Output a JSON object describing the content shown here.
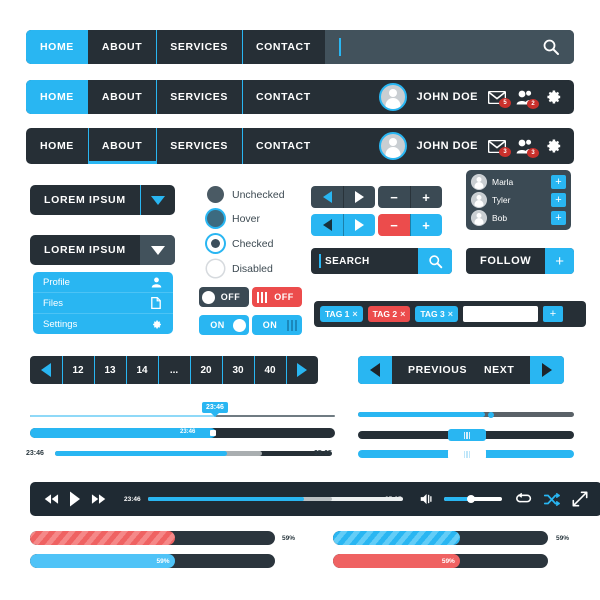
{
  "colors": {
    "blue": "#29b6f2",
    "dark": "#262f36",
    "slate": "#3b4a54",
    "red": "#ec4c4c",
    "white": "#ffffff"
  },
  "navbars": [
    {
      "id": "navbar-search",
      "items": [
        "HOME",
        "ABOUT",
        "SERVICES",
        "CONTACT"
      ],
      "active_index": 0,
      "search": {
        "value": "",
        "placeholder": ""
      }
    },
    {
      "id": "navbar-user",
      "items": [
        "HOME",
        "ABOUT",
        "SERVICES",
        "CONTACT"
      ],
      "active_index": 0,
      "username": "JOHN DOE",
      "mail_badge": "5",
      "friends_badge": "2"
    },
    {
      "id": "navbar-user-underline",
      "items": [
        "HOME",
        "ABOUT",
        "SERVICES",
        "CONTACT"
      ],
      "active_index": 1,
      "username": "JOHN DOE",
      "mail_badge": "3",
      "friends_badge": "3"
    }
  ],
  "dropdowns": [
    {
      "label": "LOREM IPSUM",
      "state": "default"
    },
    {
      "label": "LOREM IPSUM",
      "state": "hovered"
    }
  ],
  "menu": {
    "items": [
      {
        "label": "Profile",
        "icon": "user-icon"
      },
      {
        "label": "Files",
        "icon": "file-icon"
      },
      {
        "label": "Settings",
        "icon": "gear-icon"
      }
    ]
  },
  "radios": [
    {
      "label": "Unchecked",
      "state": "unchecked"
    },
    {
      "label": "Hover",
      "state": "hover"
    },
    {
      "label": "Checked",
      "state": "checked"
    },
    {
      "label": "Disabled",
      "state": "disabled"
    }
  ],
  "steppers": [
    {
      "id": "arrows-dark",
      "left": "prev-arrow-icon",
      "right": "next-arrow-icon",
      "theme": "dark"
    },
    {
      "id": "arrows-blue",
      "left": "prev-arrow-icon",
      "right": "next-arrow-icon",
      "theme": "blue"
    },
    {
      "id": "plusminus-dark",
      "left": "−",
      "right": "+",
      "theme": "dark"
    },
    {
      "id": "plusminus-color",
      "left": "−",
      "right": "+",
      "theme": "color"
    }
  ],
  "search_field": {
    "value": "SEARCH",
    "button_icon": "search-icon"
  },
  "follow_button": {
    "label": "FOLLOW",
    "plus": "+"
  },
  "user_list": [
    {
      "name": "Marla",
      "action": "+"
    },
    {
      "name": "Tyler",
      "action": "+"
    },
    {
      "name": "Bob",
      "action": "+"
    }
  ],
  "toggles": [
    {
      "id": "toggle-off-dark",
      "text": "OFF",
      "theme": "off-dark",
      "knob": "circle",
      "knob_side": "left"
    },
    {
      "id": "toggle-off-red",
      "text": "OFF",
      "theme": "off-red",
      "knob": "bars",
      "knob_side": "left"
    },
    {
      "id": "toggle-on-blue",
      "text": "ON",
      "theme": "on-blue",
      "knob": "circle",
      "knob_side": "right"
    },
    {
      "id": "toggle-on-blue-bars",
      "text": "ON",
      "theme": "on-blue",
      "knob": "bars",
      "knob_side": "right"
    }
  ],
  "tags": {
    "items": [
      {
        "label": "TAG 1",
        "color": "blue",
        "close": "×"
      },
      {
        "label": "TAG 2",
        "color": "red",
        "close": "×"
      },
      {
        "label": "TAG 3",
        "color": "blue",
        "close": "×"
      }
    ],
    "input_value": "",
    "add_label": "+"
  },
  "pagination": {
    "prev_icon": "prev-arrow-icon",
    "pages": [
      "12",
      "13",
      "14",
      "...",
      "20",
      "30",
      "40"
    ],
    "next_icon": "next-arrow-icon"
  },
  "prev_next": {
    "previous_label": "PREVIOUS",
    "next_label": "NEXT"
  },
  "sliders": {
    "tooltip_time": "23:46",
    "start_time": "23:46",
    "end_time": "35:05",
    "thin_fill_pct": 61,
    "thick_fill_pct": 61,
    "labeled_fill_pct": 62,
    "labeled_secondary_pct": 75,
    "right_thin_pct": 61,
    "right_thick_pct": 57,
    "right_light_pct": 55
  },
  "player": {
    "rewind_icon": "rewind-icon",
    "play_icon": "play-icon",
    "forward_icon": "fast-forward-icon",
    "current_time": "23:46",
    "total_time": "35:05",
    "progress_pct": 61,
    "buffer_pct": 72,
    "volume_icon": "volume-icon",
    "volume_pct": 45,
    "repeat_icon": "repeat-icon",
    "shuffle_icon": "shuffle-icon",
    "fullscreen_icon": "fullscreen-icon"
  },
  "progress_bars": [
    {
      "id": "progress-striped-red",
      "pct": 59,
      "label": "59%",
      "style": "striped-red",
      "label_pos": "outside"
    },
    {
      "id": "progress-solid-blue",
      "pct": 59,
      "label": "59%",
      "style": "blue",
      "label_pos": "inside"
    },
    {
      "id": "progress-striped-blue",
      "pct": 59,
      "label": "59%",
      "style": "striped-blue",
      "label_pos": "outside"
    },
    {
      "id": "progress-solid-red",
      "pct": 59,
      "label": "59%",
      "style": "red",
      "label_pos": "inside"
    }
  ]
}
